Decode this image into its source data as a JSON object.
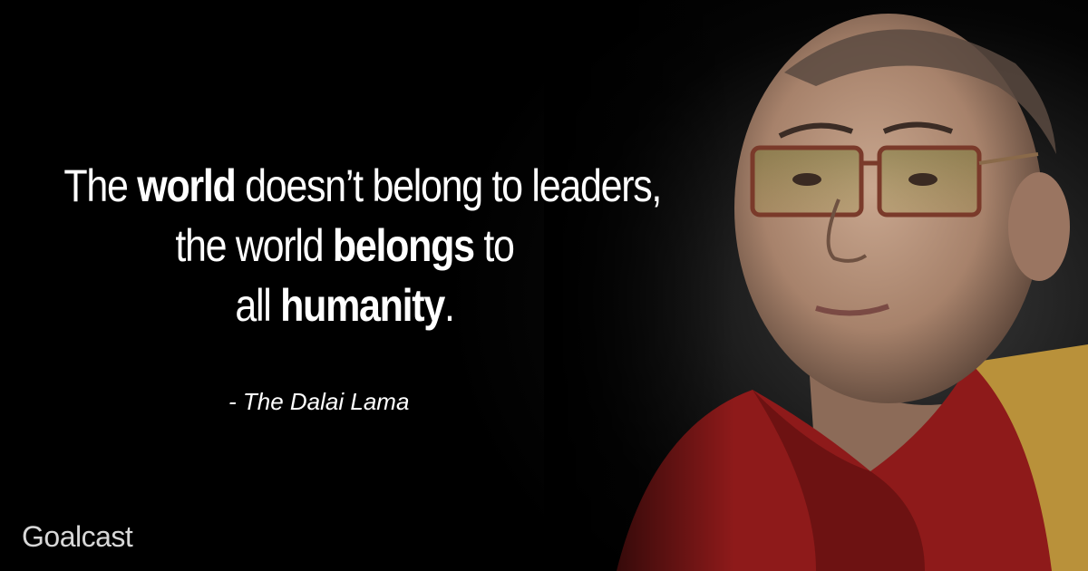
{
  "quote": {
    "lines": [
      [
        {
          "text": "The ",
          "bold": false
        },
        {
          "text": "world",
          "bold": true
        },
        {
          "text": " doesn’t belong to leaders,",
          "bold": false
        }
      ],
      [
        {
          "text": "the world ",
          "bold": false
        },
        {
          "text": "belongs",
          "bold": true
        },
        {
          "text": " to",
          "bold": false
        }
      ],
      [
        {
          "text": "all ",
          "bold": false
        },
        {
          "text": "humanity",
          "bold": true
        },
        {
          "text": ".",
          "bold": false
        }
      ]
    ]
  },
  "attribution": "- The Dalai Lama",
  "brand": "Goalcast",
  "colors": {
    "background": "#000000",
    "text": "#ffffff",
    "robe_red": "#8e1a1a",
    "robe_gold": "#b9913a",
    "brand": "#d8d8d8"
  }
}
